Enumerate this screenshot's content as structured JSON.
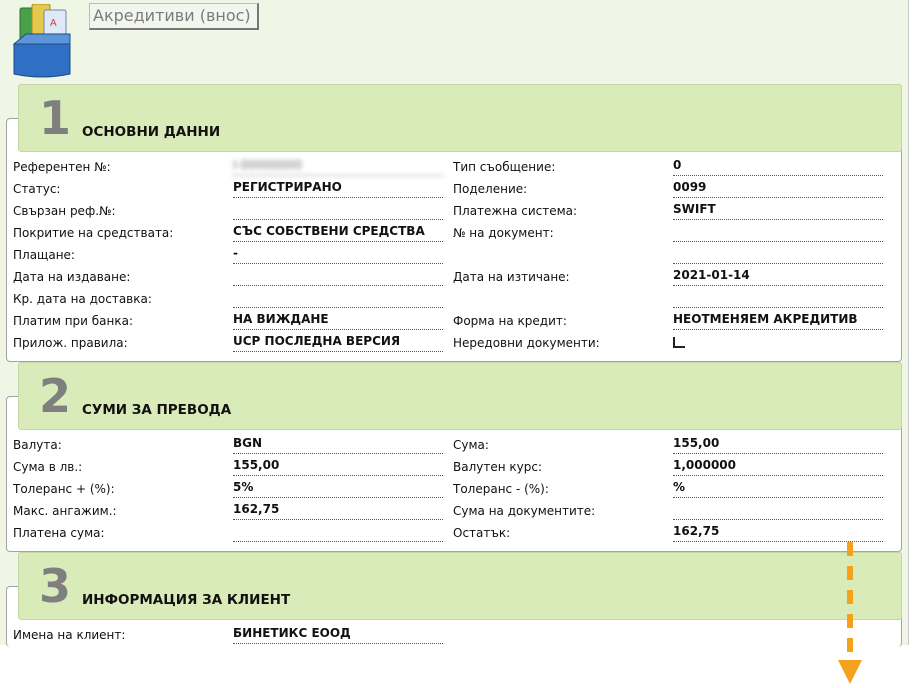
{
  "header": {
    "title": "Акредитиви (внос)"
  },
  "colors": {
    "page_bg": "#f0f6e6",
    "section_header_bg": "#d9ebb8",
    "arrow_orange": "#f4a21c"
  },
  "sections": {
    "basic": {
      "number": "1",
      "title": "ОСНОВНИ ДАННИ",
      "rows": [
        {
          "left_label": "Референтен №:",
          "left_value": "I-00000000",
          "right_label": "Тип съобщение:",
          "right_value": "0"
        },
        {
          "left_label": "Статус:",
          "left_value": "РЕГИСТРИРАНО",
          "right_label": "Поделение:",
          "right_value": "0099"
        },
        {
          "left_label": "Свързан реф.№:",
          "left_value": "",
          "right_label": "Платежна система:",
          "right_value": "SWIFT"
        },
        {
          "left_label": "Покритие на средствата:",
          "left_value": "СЪС СОБСТВЕНИ СРЕДСТВА",
          "right_label": "№ на документ:",
          "right_value": ""
        },
        {
          "left_label": "Плащане:",
          "left_value": "-",
          "right_label": "",
          "right_value": ""
        },
        {
          "left_label": "Дата на издаване:",
          "left_value": "",
          "right_label": "Дата на изтичане:",
          "right_value": "2021-01-14"
        },
        {
          "left_label": "Кр. дата на доставка:",
          "left_value": "",
          "right_label": "",
          "right_value": ""
        },
        {
          "left_label": "Платим при банка:",
          "left_value": "НА ВИЖДАНЕ",
          "right_label": "Форма на кредит:",
          "right_value": "НЕОТМЕНЯЕМ АКРЕДИТИВ"
        },
        {
          "left_label": "Прилож. правила:",
          "left_value": "UCP ПОСЛЕДНА ВЕРСИЯ",
          "right_label": "Нередовни документи:",
          "right_value": ""
        }
      ]
    },
    "amounts": {
      "number": "2",
      "title": "СУМИ ЗА ПРЕВОДА",
      "rows": [
        {
          "left_label": "Валута:",
          "left_value": "BGN",
          "right_label": "Сума:",
          "right_value": "155,00"
        },
        {
          "left_label": "Сума в лв.:",
          "left_value": "155,00",
          "right_label": "Валутен курс:",
          "right_value": "1,000000"
        },
        {
          "left_label": "Толеранс + (%):",
          "left_value": "5%",
          "right_label": "Толеранс - (%):",
          "right_value": "%"
        },
        {
          "left_label": "Макс. ангажим.:",
          "left_value": "162,75",
          "right_label": "Сума на документите:",
          "right_value": ""
        },
        {
          "left_label": "Платена сума:",
          "left_value": "",
          "right_label": "Остатък:",
          "right_value": "162,75"
        }
      ]
    },
    "client": {
      "number": "3",
      "title": "ИНФОРМАЦИЯ ЗА КЛИЕНТ",
      "rows": [
        {
          "left_label": "Имена на клиент:",
          "left_value": "БИНЕТИКС ЕООД",
          "right_label": "",
          "right_value": ""
        }
      ]
    }
  }
}
